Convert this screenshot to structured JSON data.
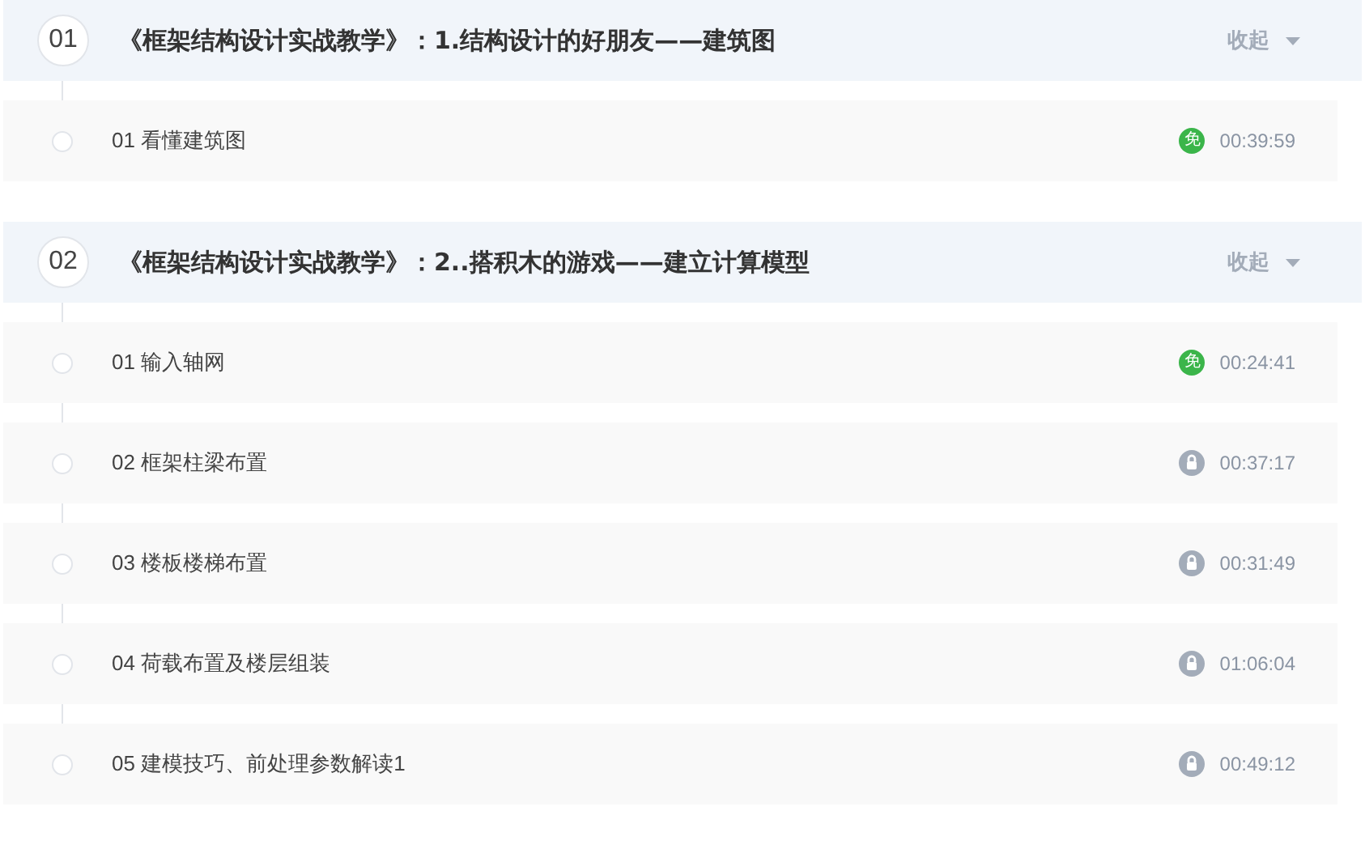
{
  "sections": [
    {
      "number": "01",
      "title": "《框架结构设计实战教学》：1.结构设计的好朋友——建筑图",
      "toggle": "收起",
      "expanded": true,
      "lessons": [
        {
          "title": "01 看懂建筑图",
          "kind": "free",
          "badge": "免",
          "duration": "00:39:59"
        }
      ]
    },
    {
      "number": "02",
      "title": "《框架结构设计实战教学》：2..搭积木的游戏——建立计算模型",
      "toggle": "收起",
      "expanded": true,
      "lessons": [
        {
          "title": "01 输入轴网",
          "kind": "free",
          "badge": "免",
          "duration": "00:24:41"
        },
        {
          "title": "02 框架柱梁布置",
          "kind": "locked",
          "duration": "00:37:17"
        },
        {
          "title": "03 楼板楼梯布置",
          "kind": "locked",
          "duration": "00:31:49"
        },
        {
          "title": "04 荷载布置及楼层组装",
          "kind": "locked",
          "duration": "01:06:04"
        },
        {
          "title": "05 建模技巧、前处理参数解读1",
          "kind": "locked",
          "duration": "00:49:12"
        }
      ]
    }
  ]
}
